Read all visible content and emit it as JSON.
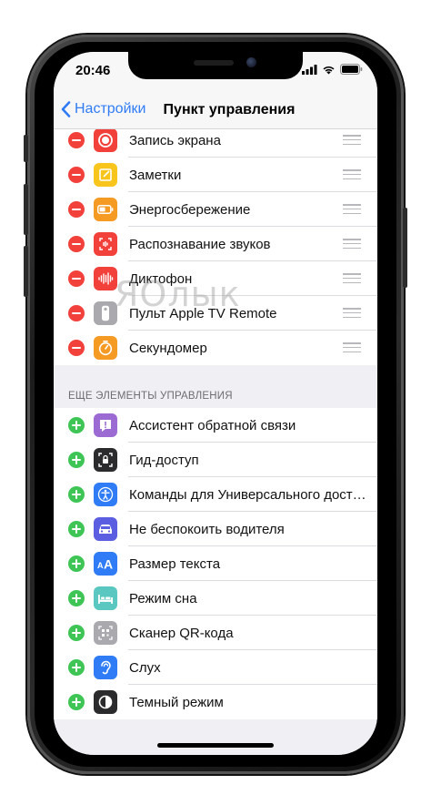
{
  "status": {
    "time": "20:46"
  },
  "nav": {
    "back_label": "Настройки",
    "title": "Пункт управления"
  },
  "included": [
    {
      "label": "Запись экрана",
      "icon": "screen-record-icon",
      "color": "#f2403b"
    },
    {
      "label": "Заметки",
      "icon": "notes-icon",
      "color": "#f8c51c"
    },
    {
      "label": "Энергосбережение",
      "icon": "battery-icon",
      "color": "#f59a23"
    },
    {
      "label": "Распознавание звуков",
      "icon": "sound-recognition-icon",
      "color": "#f2403b"
    },
    {
      "label": "Диктофон",
      "icon": "voice-memo-icon",
      "color": "#f2403b"
    },
    {
      "label": "Пульт Apple TV Remote",
      "icon": "remote-icon",
      "color": "#8e8e93"
    },
    {
      "label": "Секундомер",
      "icon": "stopwatch-icon",
      "color": "#f59a23"
    }
  ],
  "more_section_title": "ЕЩЕ ЭЛЕМЕНТЫ УПРАВЛЕНИЯ",
  "more": [
    {
      "label": "Ассистент обратной связи",
      "icon": "feedback-icon",
      "color": "#9b6bd3"
    },
    {
      "label": "Гид-доступ",
      "icon": "guided-access-icon",
      "color": "#2b2b2d"
    },
    {
      "label": "Команды для Универсального дост…",
      "icon": "accessibility-icon",
      "color": "#2f7cf6"
    },
    {
      "label": "Не беспокоить водителя",
      "icon": "car-icon",
      "color": "#5b5ee0"
    },
    {
      "label": "Размер текста",
      "icon": "text-size-icon",
      "color": "#2f7cf6"
    },
    {
      "label": "Режим сна",
      "icon": "bed-icon",
      "color": "#5ac8c0"
    },
    {
      "label": "Сканер QR-кода",
      "icon": "qr-code-icon",
      "color": "#8e8e93"
    },
    {
      "label": "Слух",
      "icon": "ear-icon",
      "color": "#2f7cf6"
    },
    {
      "label": "Темный режим",
      "icon": "dark-mode-icon",
      "color": "#2b2b2d"
    }
  ],
  "watermark": "ЯОлык",
  "colors": {
    "accent": "#2f7cf6",
    "remove": "#f2403b",
    "add": "#3ec556"
  }
}
